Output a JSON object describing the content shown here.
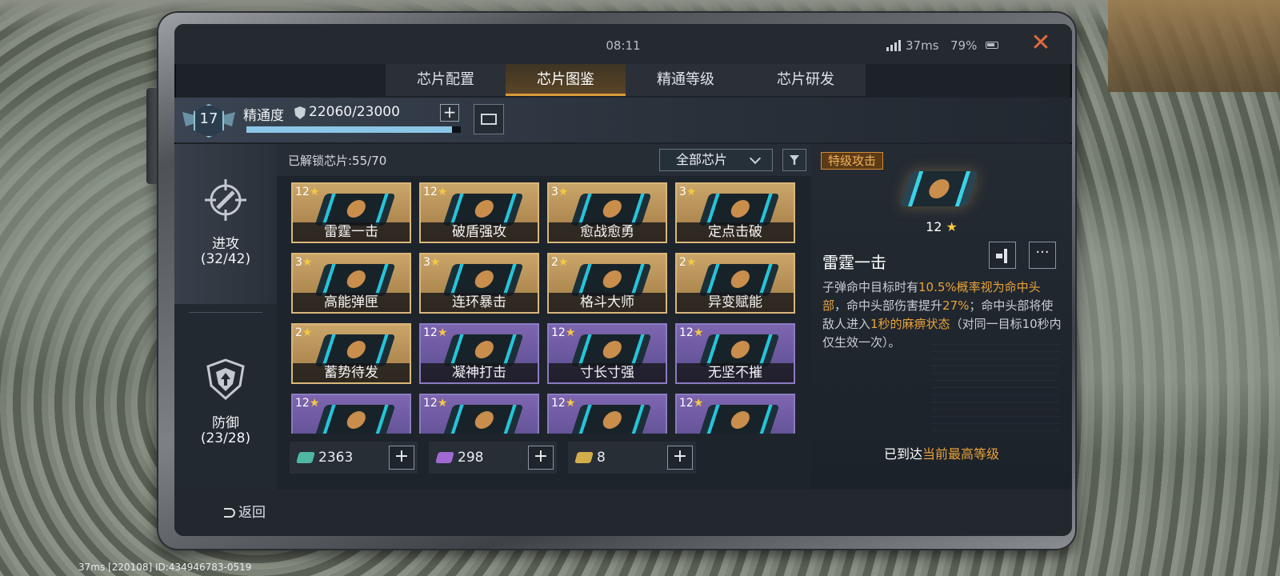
{
  "status": {
    "time": "08:11",
    "ping": "37ms",
    "battery": "79%"
  },
  "tabs": [
    {
      "label": "芯片配置",
      "active": false
    },
    {
      "label": "芯片图鉴",
      "active": true
    },
    {
      "label": "精通等级",
      "active": false
    },
    {
      "label": "芯片研发",
      "active": false
    }
  ],
  "mastery": {
    "level": "17",
    "label": "精通度",
    "value": "22060/23000",
    "progress": 0.959
  },
  "categories": [
    {
      "name": "进攻",
      "count": "(32/42)"
    },
    {
      "name": "防御",
      "count": "(23/28)"
    }
  ],
  "grid": {
    "unlocked": "已解锁芯片:55/70",
    "filter": "全部芯片",
    "chips": [
      {
        "stars": "12",
        "name": "雷霆一击",
        "tier": "gold"
      },
      {
        "stars": "12",
        "name": "破盾强攻",
        "tier": "gold"
      },
      {
        "stars": "3",
        "name": "愈战愈勇",
        "tier": "gold"
      },
      {
        "stars": "3",
        "name": "定点击破",
        "tier": "gold"
      },
      {
        "stars": "3",
        "name": "高能弹匣",
        "tier": "gold"
      },
      {
        "stars": "3",
        "name": "连环暴击",
        "tier": "gold"
      },
      {
        "stars": "2",
        "name": "格斗大师",
        "tier": "gold"
      },
      {
        "stars": "2",
        "name": "异变赋能",
        "tier": "gold"
      },
      {
        "stars": "2",
        "name": "蓄势待发",
        "tier": "gold"
      },
      {
        "stars": "12",
        "name": "凝神打击",
        "tier": "purple"
      },
      {
        "stars": "12",
        "name": "寸长寸强",
        "tier": "purple"
      },
      {
        "stars": "12",
        "name": "无坚不摧",
        "tier": "purple"
      },
      {
        "stars": "12",
        "name": "",
        "tier": "purple"
      },
      {
        "stars": "12",
        "name": "",
        "tier": "purple"
      },
      {
        "stars": "12",
        "name": "",
        "tier": "purple"
      },
      {
        "stars": "12",
        "name": "",
        "tier": "purple"
      }
    ]
  },
  "resources": [
    {
      "value": "2363",
      "color": "#4fb7a4"
    },
    {
      "value": "298",
      "color": "#a06ad2"
    },
    {
      "value": "8",
      "color": "#d2ad4a"
    }
  ],
  "detail": {
    "tag": "特级攻击",
    "stars": "12",
    "title": "雷霆一击",
    "desc": [
      {
        "t": "子弹命中目标时有",
        "hl": false
      },
      {
        "t": "10.5%概率视为命中头部",
        "hl": true
      },
      {
        "t": "，命中头部伤害提升",
        "hl": false
      },
      {
        "t": "27%",
        "hl": true
      },
      {
        "t": "；命中头部将使敌人进入",
        "hl": false
      },
      {
        "t": "1秒的麻痹状态",
        "hl": true
      },
      {
        "t": "（对同一目标10秒内仅生效一次）。",
        "hl": false
      }
    ],
    "maxed_prefix": "已到达",
    "maxed_hl": "当前最高等级"
  },
  "back_label": "返回",
  "footer": "37ms [220108] ID:434946783-0519"
}
